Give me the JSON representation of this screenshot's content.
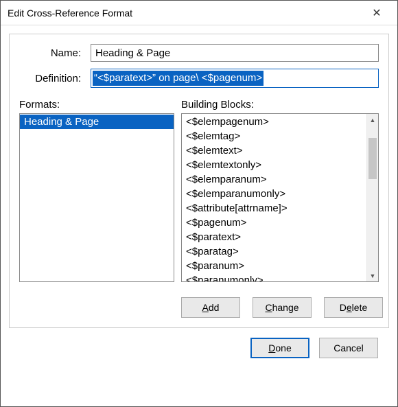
{
  "window": {
    "title": "Edit Cross-Reference Format"
  },
  "labels": {
    "name": "Name:",
    "definition": "Definition:",
    "formats": "Formats:",
    "building_blocks": "Building Blocks:"
  },
  "fields": {
    "name_value": "Heading & Page",
    "definition_value": "“<$paratext>” on page\\ <$pagenum>"
  },
  "formats": {
    "items": [
      {
        "label": "Heading & Page",
        "selected": true
      }
    ]
  },
  "building_blocks": {
    "items": [
      "<$elempagenum>",
      "<$elemtag>",
      "<$elemtext>",
      "<$elemtextonly>",
      "<$elemparanum>",
      "<$elemparanumonly>",
      "<$attribute[attrname]>",
      "<$pagenum>",
      "<$paratext>",
      "<$paratag>",
      "<$paranum>",
      "<$paranumonly>"
    ]
  },
  "buttons": {
    "add": "Add",
    "change": "Change",
    "delete": "Delete",
    "done": "Done",
    "cancel": "Cancel"
  }
}
